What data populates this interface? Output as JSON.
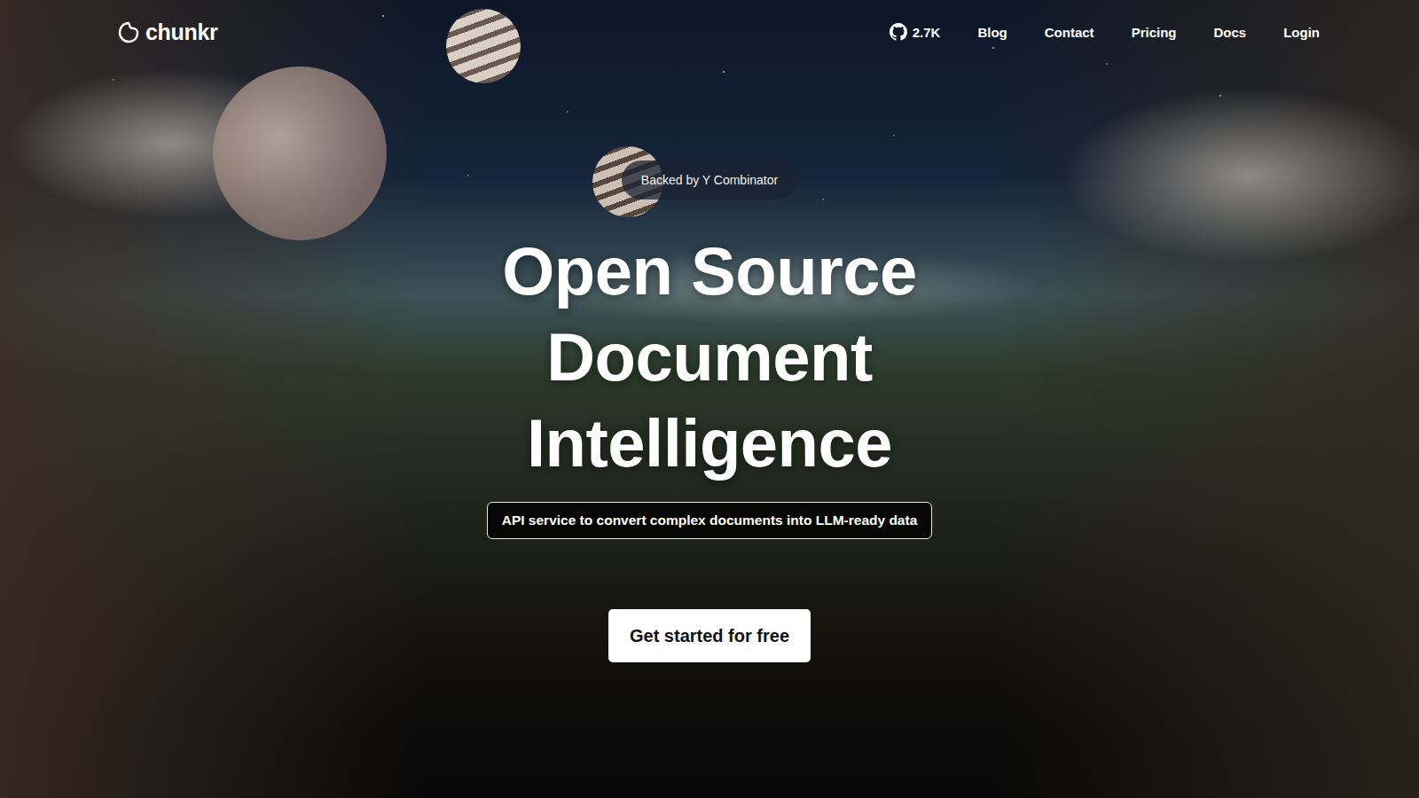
{
  "nav": {
    "logo": "chunkr",
    "github_stars": "2.7K",
    "links": [
      "Blog",
      "Contact",
      "Pricing",
      "Docs",
      "Login"
    ]
  },
  "hero": {
    "badge": "Backed by Y Combinator",
    "title_lines": [
      "Open Source",
      "Document",
      "Intelligence"
    ],
    "subtitle": "API service to convert complex documents into LLM-ready data",
    "cta": "Get started for free"
  }
}
